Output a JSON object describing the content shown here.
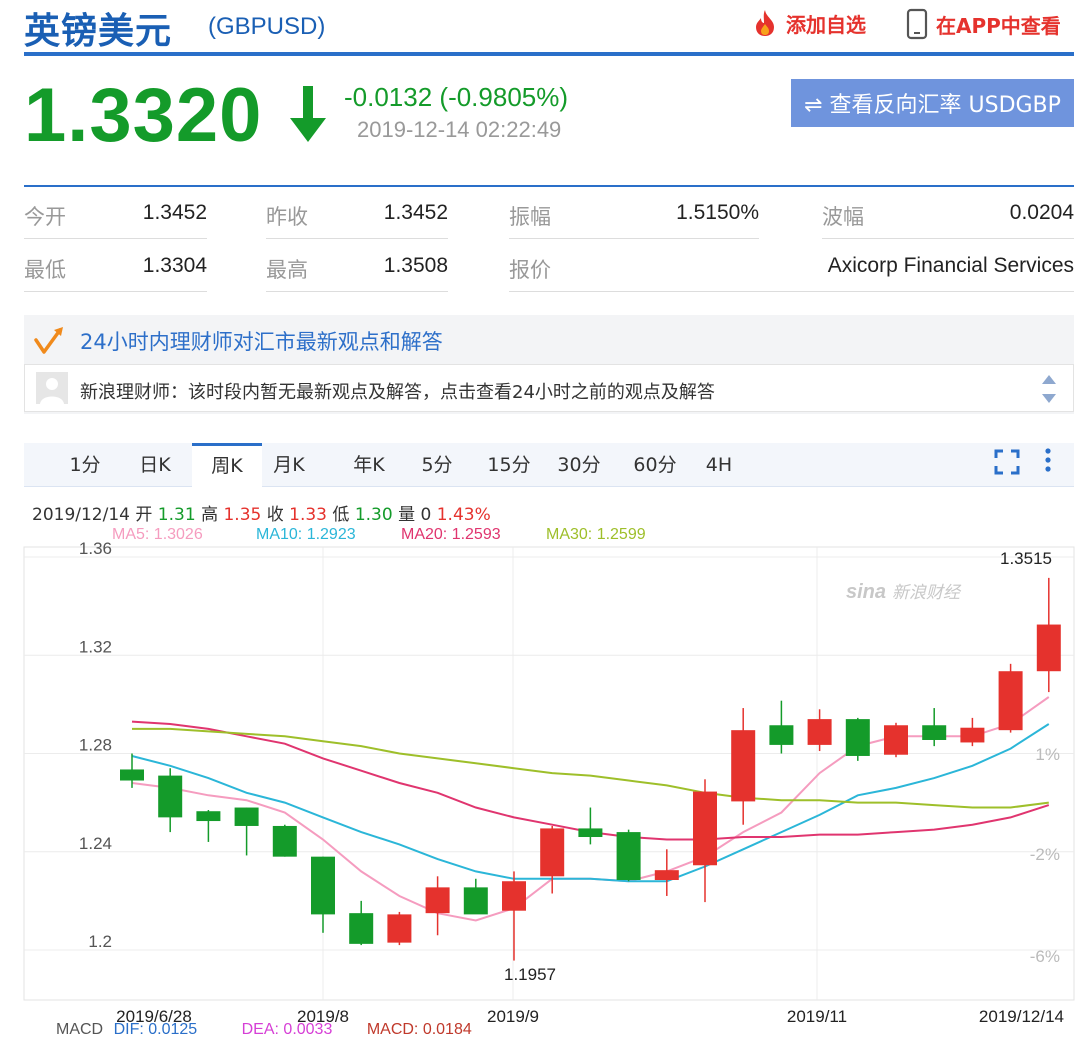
{
  "header": {
    "title": "英镑美元",
    "code": "(GBPUSD)",
    "add_watchlist": "添加自选",
    "view_in_app": "在APP中查看"
  },
  "quote": {
    "price": "1.3320",
    "change": "-0.0132 (-0.9805%)",
    "time": "2019-12-14 02:22:49",
    "reverse_button": "⇌ 查看反向汇率 USDGBP"
  },
  "stats": {
    "row1": [
      {
        "label": "今开",
        "value": "1.3452"
      },
      {
        "label": "昨收",
        "value": "1.3452"
      },
      {
        "label": "振幅",
        "value": "1.5150%"
      },
      {
        "label": "波幅",
        "value": "0.0204"
      }
    ],
    "row2": [
      {
        "label": "最低",
        "value": "1.3304"
      },
      {
        "label": "最高",
        "value": "1.3508"
      },
      {
        "label": "报价",
        "value": "Axicorp Financial Services"
      }
    ]
  },
  "advisor": {
    "title": "24小时内理财师对汇市最新观点和解答",
    "message": "新浪理财师：该时段内暂无最新观点及解答，点击查看24小时之前的观点及解答"
  },
  "tabs": [
    "1分",
    "日K",
    "周K",
    "月K",
    "年K",
    "5分",
    "15分",
    "30分",
    "60分",
    "4H"
  ],
  "active_tab": "周K",
  "ohlc": {
    "date": "2019/12/14",
    "open_label": "开",
    "open": "1.31",
    "high_label": "高",
    "high": "1.35",
    "close_label": "收",
    "close": "1.33",
    "low_label": "低",
    "low": "1.30",
    "vol_label": "量",
    "vol": "0",
    "pct": "1.43%"
  },
  "ma_labels": {
    "ma5": "MA5: 1.3026",
    "ma10": "MA10: 1.2923",
    "ma20": "MA20: 1.2593",
    "ma30": "MA30: 1.2599"
  },
  "macd_labels": {
    "macd_prefix": "MACD",
    "dif": "DIF: 0.0125",
    "dea": "DEA: 0.0033",
    "macd": "MACD: 0.0184"
  },
  "colors": {
    "up": "#e5322d",
    "down": "#149b2a",
    "accent": "#2a6fc9",
    "ma5": "#f59cbf",
    "ma10": "#2bb6d8",
    "ma20": "#e0356f",
    "ma30": "#9ebf2a"
  },
  "chart_data": {
    "type": "candlestick",
    "interval": "weekly",
    "y_ticks": [
      "1.36",
      "1.32",
      "1.28",
      "1.24",
      "1.2"
    ],
    "ylim": [
      1.1957,
      1.3515
    ],
    "pct_ticks": [
      "1%",
      "-2%",
      "-6%"
    ],
    "x_ticks": [
      "2019/6/28",
      "2019/8",
      "2019/9",
      "2019/11",
      "2019/12/14"
    ],
    "high_label": "1.3515",
    "low_label": "1.1957",
    "watermark": "新浪财经",
    "candles": [
      {
        "o": 1.2735,
        "h": 1.28,
        "l": 1.266,
        "c": 1.269
      },
      {
        "o": 1.271,
        "h": 1.274,
        "l": 1.248,
        "c": 1.254
      },
      {
        "o": 1.2565,
        "h": 1.257,
        "l": 1.244,
        "c": 1.2525
      },
      {
        "o": 1.258,
        "h": 1.258,
        "l": 1.2385,
        "c": 1.2505
      },
      {
        "o": 1.2505,
        "h": 1.251,
        "l": 1.238,
        "c": 1.238
      },
      {
        "o": 1.238,
        "h": 1.238,
        "l": 1.207,
        "c": 1.2145
      },
      {
        "o": 1.215,
        "h": 1.22,
        "l": 1.202,
        "c": 1.2025
      },
      {
        "o": 1.203,
        "h": 1.2155,
        "l": 1.202,
        "c": 1.2145
      },
      {
        "o": 1.215,
        "h": 1.23,
        "l": 1.206,
        "c": 1.2255
      },
      {
        "o": 1.2255,
        "h": 1.229,
        "l": 1.215,
        "c": 1.2145
      },
      {
        "o": 1.216,
        "h": 1.232,
        "l": 1.1957,
        "c": 1.228
      },
      {
        "o": 1.23,
        "h": 1.2505,
        "l": 1.223,
        "c": 1.2495
      },
      {
        "o": 1.2495,
        "h": 1.258,
        "l": 1.243,
        "c": 1.246
      },
      {
        "o": 1.248,
        "h": 1.249,
        "l": 1.228,
        "c": 1.2285
      },
      {
        "o": 1.2285,
        "h": 1.241,
        "l": 1.222,
        "c": 1.2325
      },
      {
        "o": 1.2345,
        "h": 1.2695,
        "l": 1.2195,
        "c": 1.2645
      },
      {
        "o": 1.2605,
        "h": 1.2985,
        "l": 1.251,
        "c": 1.2895
      },
      {
        "o": 1.2915,
        "h": 1.3015,
        "l": 1.28,
        "c": 1.2835
      },
      {
        "o": 1.2835,
        "h": 1.298,
        "l": 1.281,
        "c": 1.294
      },
      {
        "o": 1.294,
        "h": 1.2945,
        "l": 1.277,
        "c": 1.279
      },
      {
        "o": 1.2795,
        "h": 1.2925,
        "l": 1.2785,
        "c": 1.2915
      },
      {
        "o": 1.2915,
        "h": 1.2985,
        "l": 1.283,
        "c": 1.2855
      },
      {
        "o": 1.2845,
        "h": 1.2945,
        "l": 1.283,
        "c": 1.2905
      },
      {
        "o": 1.2895,
        "h": 1.3165,
        "l": 1.2885,
        "c": 1.3135
      },
      {
        "o": 1.3135,
        "h": 1.3515,
        "l": 1.305,
        "c": 1.3325
      }
    ],
    "series": [
      {
        "name": "MA5",
        "values": [
          1.268,
          1.266,
          1.263,
          1.261,
          1.256,
          1.245,
          1.232,
          1.222,
          1.215,
          1.212,
          1.217,
          1.229,
          1.229,
          1.228,
          1.232,
          1.238,
          1.248,
          1.256,
          1.272,
          1.283,
          1.287,
          1.287,
          1.287,
          1.292,
          1.303
        ]
      },
      {
        "name": "MA10",
        "values": [
          1.279,
          1.275,
          1.27,
          1.264,
          1.26,
          1.254,
          1.248,
          1.243,
          1.237,
          1.232,
          1.229,
          1.229,
          1.229,
          1.228,
          1.228,
          1.234,
          1.241,
          1.248,
          1.255,
          1.263,
          1.266,
          1.27,
          1.275,
          1.282,
          1.292
        ]
      },
      {
        "name": "MA20",
        "values": [
          1.293,
          1.292,
          1.29,
          1.287,
          1.284,
          1.278,
          1.273,
          1.268,
          1.264,
          1.258,
          1.254,
          1.251,
          1.248,
          1.246,
          1.245,
          1.245,
          1.246,
          1.246,
          1.247,
          1.247,
          1.248,
          1.249,
          1.251,
          1.254,
          1.259
        ]
      },
      {
        "name": "MA30",
        "values": [
          1.29,
          1.29,
          1.289,
          1.288,
          1.287,
          1.285,
          1.283,
          1.28,
          1.278,
          1.276,
          1.274,
          1.272,
          1.271,
          1.269,
          1.267,
          1.264,
          1.262,
          1.261,
          1.261,
          1.26,
          1.26,
          1.259,
          1.258,
          1.258,
          1.26
        ]
      }
    ]
  }
}
